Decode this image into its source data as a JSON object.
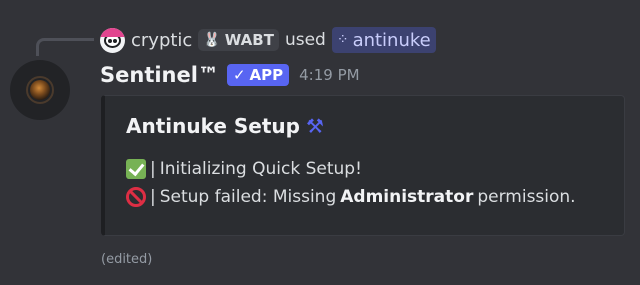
{
  "reference": {
    "username": "cryptic",
    "tag": "WABT",
    "tag_icon": "🐰",
    "used_label": "used",
    "command": "antinuke",
    "command_icon": "⁘"
  },
  "message": {
    "author": "Sentinel™",
    "app_badge_check": "✓",
    "app_badge": "APP",
    "timestamp": "4:19 PM",
    "edited_label": "(edited)"
  },
  "embed": {
    "title": "Antinuke Setup",
    "title_icon": "⚒",
    "line1_sep": "|",
    "line1_text": "Initializing Quick Setup!",
    "line2_sep": "|",
    "line2_prefix": "Setup failed: Missing",
    "line2_bold": "Administrator",
    "line2_suffix": "permission."
  },
  "colors": {
    "background": "#323338",
    "embed_bg": "#2b2d31",
    "app_badge": "#5865f2",
    "command_bg": "#3c4270",
    "check": "#77b255",
    "prohibited": "#dd2e44"
  },
  "icons": {
    "reference_avatar": "user-avatar-icon",
    "bot_avatar": "bot-avatar-icon",
    "title_icon": "hammer-pick-icon",
    "line1_icon": "check-mark-icon",
    "line2_icon": "prohibited-icon"
  }
}
